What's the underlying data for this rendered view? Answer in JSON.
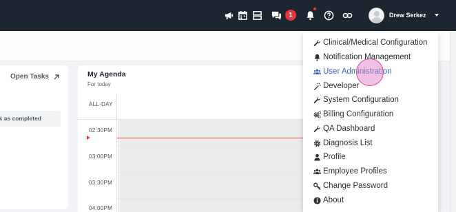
{
  "topbar": {
    "icons": [
      "megaphone-icon",
      "calendar-icon",
      "server-icon",
      "chat-icon",
      "bell-icon",
      "help-icon",
      "link-icon"
    ],
    "message_count": "1",
    "user_name": "Drew Serkez"
  },
  "tasks": {
    "title": "Open Tasks",
    "row_text": "k as completed"
  },
  "agenda": {
    "title": "My Agenda",
    "subtitle": "For today",
    "allday_label": "ALL-DAY",
    "times": [
      "02:30PM",
      "03:00PM",
      "03:30PM",
      "04:00PM"
    ]
  },
  "menu": {
    "items": [
      {
        "label": "Clinical/Medical Configuration",
        "icon": "wrench-icon"
      },
      {
        "label": "Notification Management",
        "icon": "bell-icon"
      },
      {
        "label": "User Administration",
        "icon": "users-icon"
      },
      {
        "label": "Developer",
        "icon": "magic-wand-icon"
      },
      {
        "label": "System Configuration",
        "icon": "wrench-icon"
      },
      {
        "label": "Billing Configuration",
        "icon": "cogs-icon"
      },
      {
        "label": "QA Dashboard",
        "icon": "wrench-icon"
      },
      {
        "label": "Diagnosis List",
        "icon": "gear-icon"
      },
      {
        "label": "Profile",
        "icon": "user-icon"
      },
      {
        "label": "Employee Profiles",
        "icon": "users-icon"
      },
      {
        "label": "Change Password",
        "icon": "key-icon"
      },
      {
        "label": "About",
        "icon": "info-icon"
      }
    ],
    "active_index": 2
  },
  "colors": {
    "topbar": "#1b2631",
    "accent": "#3d62c9",
    "badge": "#e8333a",
    "now_line": "#e33a3a"
  }
}
